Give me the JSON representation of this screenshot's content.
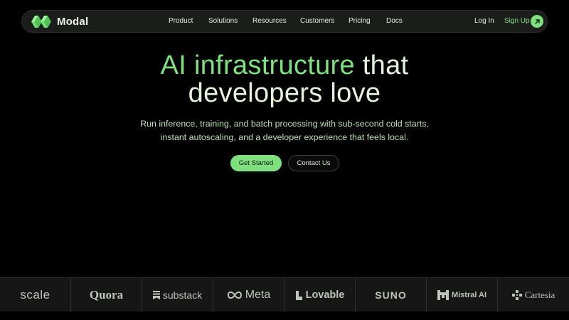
{
  "brand": {
    "name": "Modal",
    "accent": "#7ee07f"
  },
  "nav": {
    "links": [
      "Product",
      "Solutions",
      "Resources",
      "Customers",
      "Pricing",
      "Docs"
    ],
    "login": "Log In",
    "signup": "Sign Up",
    "signup_icon": "arrow-up-right-icon"
  },
  "hero": {
    "title_accent": "AI infrastructure",
    "title_plain_1": "that",
    "title_plain_2": "developers love",
    "subtitle": "Run inference, training, and batch processing with sub-second cold starts, instant autoscaling, and a developer experience that feels local.",
    "primary_cta": "Get Started",
    "secondary_cta": "Contact Us"
  },
  "customers": [
    "scale",
    "Quora",
    "substack",
    "Meta",
    "Lovable",
    "SUNO",
    "Mistral AI",
    "Cartesia"
  ]
}
